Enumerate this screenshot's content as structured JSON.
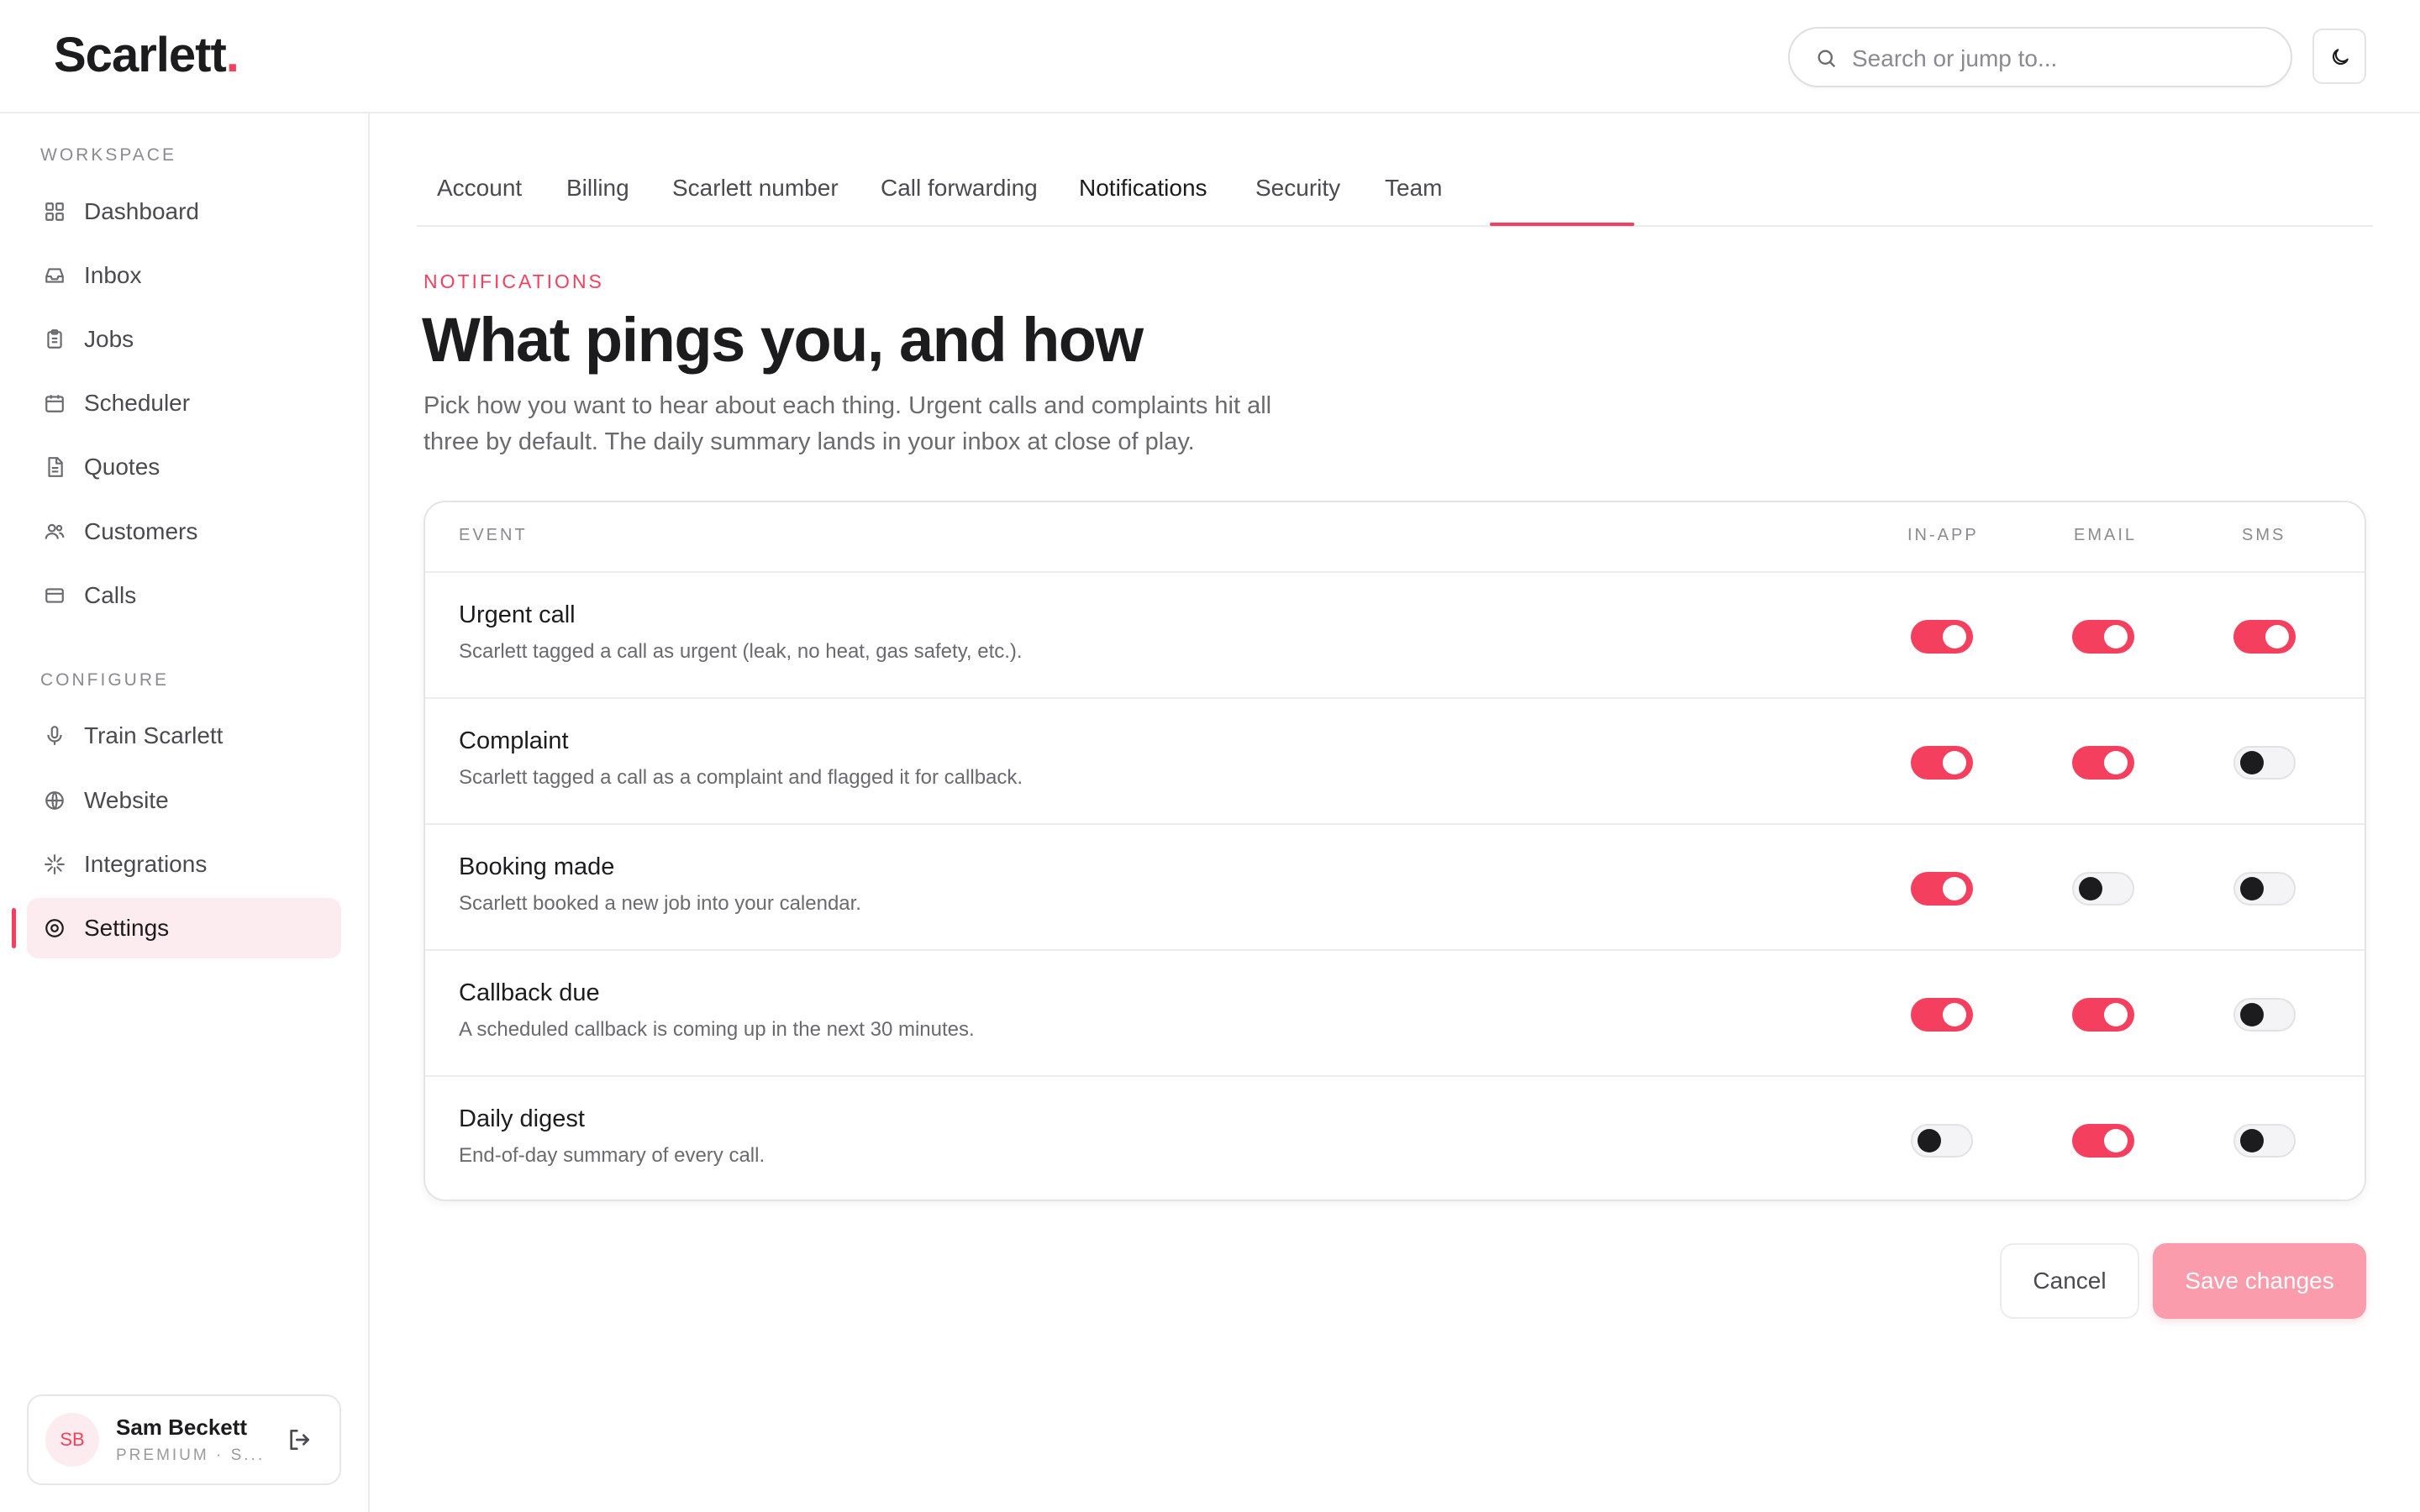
{
  "header": {
    "logo": "Scarlett",
    "logo_dot": ".",
    "search_placeholder": "Search or jump to..."
  },
  "sidebar": {
    "workspace_label": "WORKSPACE",
    "workspace_items": [
      {
        "label": "Dashboard",
        "icon": "grid-icon"
      },
      {
        "label": "Inbox",
        "icon": "inbox-icon"
      },
      {
        "label": "Jobs",
        "icon": "clipboard-icon"
      },
      {
        "label": "Scheduler",
        "icon": "calendar-icon"
      },
      {
        "label": "Quotes",
        "icon": "document-icon"
      },
      {
        "label": "Customers",
        "icon": "users-icon"
      },
      {
        "label": "Calls",
        "icon": "card-icon"
      }
    ],
    "configure_label": "CONFIGURE",
    "configure_items": [
      {
        "label": "Train Scarlett",
        "icon": "microphone-icon"
      },
      {
        "label": "Website",
        "icon": "globe-icon"
      },
      {
        "label": "Integrations",
        "icon": "sparkle-icon"
      },
      {
        "label": "Settings",
        "icon": "settings-icon",
        "active": true
      }
    ],
    "user": {
      "initials": "SB",
      "name": "Sam Beckett",
      "plan": "PREMIUM · S..."
    }
  },
  "tabs": [
    "Account",
    "Billing",
    "Scarlett number",
    "Call forwarding",
    "Notifications",
    "Security",
    "Team"
  ],
  "active_tab": "Notifications",
  "content": {
    "eyebrow": "NOTIFICATIONS",
    "title": "What pings you, and how",
    "description": "Pick how you want to hear about each thing. Urgent calls and complaints hit all three by default. The daily summary lands in your inbox at close of play."
  },
  "table": {
    "headers": {
      "event": "EVENT",
      "in_app": "IN-APP",
      "email": "EMAIL",
      "sms": "SMS"
    },
    "rows": [
      {
        "title": "Urgent call",
        "desc": "Scarlett tagged a call as urgent (leak, no heat, gas safety, etc.).",
        "in_app": true,
        "email": true,
        "sms": true
      },
      {
        "title": "Complaint",
        "desc": "Scarlett tagged a call as a complaint and flagged it for callback.",
        "in_app": true,
        "email": true,
        "sms": false
      },
      {
        "title": "Booking made",
        "desc": "Scarlett booked a new job into your calendar.",
        "in_app": true,
        "email": false,
        "sms": false
      },
      {
        "title": "Callback due",
        "desc": "A scheduled callback is coming up in the next 30 minutes.",
        "in_app": true,
        "email": true,
        "sms": false
      },
      {
        "title": "Daily digest",
        "desc": "End-of-day summary of every call.",
        "in_app": false,
        "email": true,
        "sms": false
      }
    ]
  },
  "actions": {
    "cancel": "Cancel",
    "save": "Save changes"
  },
  "colors": {
    "accent": "#f43f5e",
    "accent_light": "#fdecef",
    "save_disabled": "#fb9cad"
  }
}
